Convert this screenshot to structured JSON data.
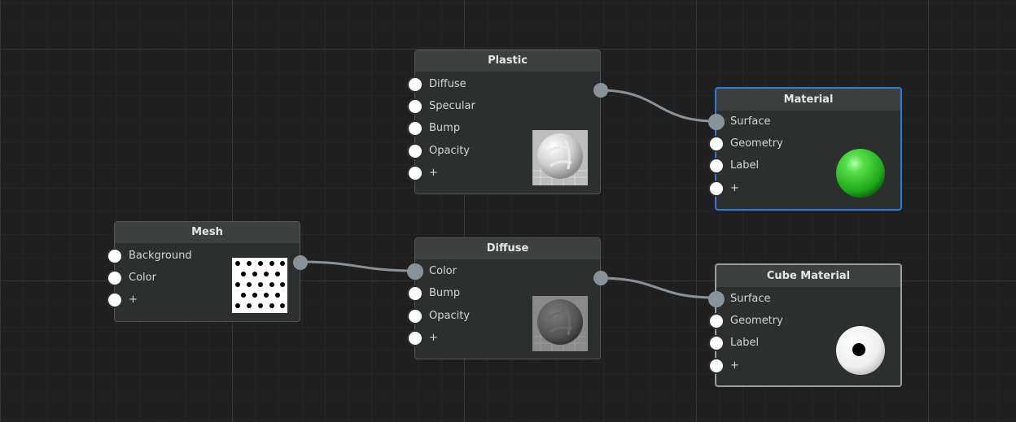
{
  "nodes": {
    "plastic": {
      "title": "Plastic",
      "inputs": [
        "Diffuse",
        "Specular",
        "Bump",
        "Opacity",
        "+"
      ],
      "preview": "light-gray-sphere"
    },
    "material": {
      "title": "Material",
      "inputs": [
        "Surface",
        "Geometry",
        "Label",
        "+"
      ],
      "preview": "green-sphere",
      "accent": "#2c7be5"
    },
    "mesh": {
      "title": "Mesh",
      "inputs": [
        "Background",
        "Color",
        "+"
      ],
      "preview": "polka-dot-pattern"
    },
    "diffuse": {
      "title": "Diffuse",
      "inputs": [
        "Color",
        "Bump",
        "Opacity",
        "+"
      ],
      "preview": "dark-gray-sphere"
    },
    "cube_material": {
      "title": "Cube Material",
      "inputs": [
        "Surface",
        "Geometry",
        "Label",
        "+"
      ],
      "preview": "white-eyeball-sphere"
    }
  },
  "connections": [
    {
      "from": "plastic",
      "to": "material.Surface"
    },
    {
      "from": "mesh",
      "to": "diffuse.Color"
    },
    {
      "from": "diffuse",
      "to": "cube_material.Surface"
    }
  ],
  "colors": {
    "canvas": "#1f1f1f",
    "wire": "#8a9299",
    "selected_border": "#2c7be5",
    "node_body": "#2d2e2e",
    "node_header": "#3e4040"
  }
}
